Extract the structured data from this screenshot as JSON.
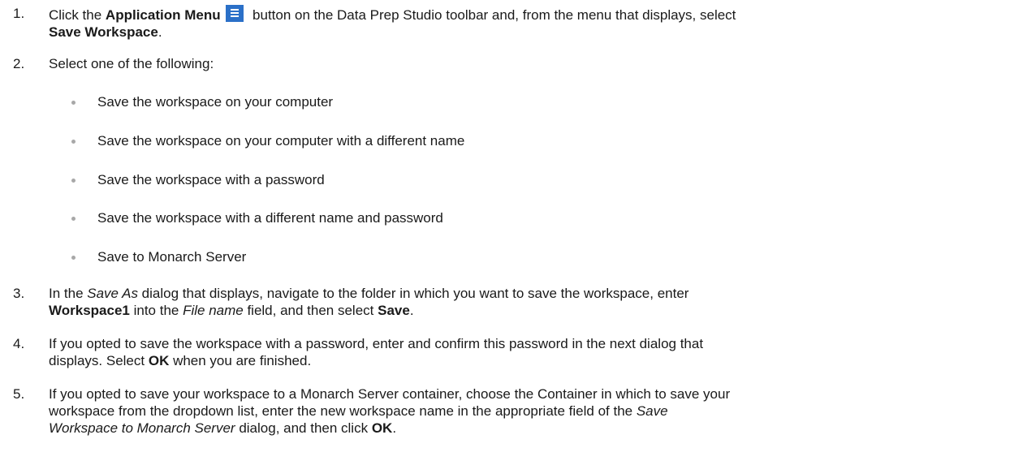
{
  "steps": [
    {
      "num": "1.",
      "t1": "Click the ",
      "b1": "Application Menu",
      "icon": "hamburger-menu-icon",
      "t2": " button on the Data Prep Studio toolbar and, from the menu that displays, select",
      "b2": "Save Workspace",
      "t3": "."
    },
    {
      "num": "2.",
      "t1": "Select one of the following:"
    },
    {
      "num": "3.",
      "t1": "In the ",
      "i1": "Save As",
      "t2": " dialog that displays, navigate to the folder in which you want to save the workspace, enter",
      "b1": "Workspace1",
      "t3": " into the ",
      "i2": "File name",
      "t4": " field, and then select ",
      "b2": "Save",
      "t5": "."
    },
    {
      "num": "4.",
      "t1": "If you opted to save the workspace with a password, enter and confirm this password in the next dialog that",
      "t2": "displays. Select ",
      "b1": "OK",
      "t3": " when you are finished."
    },
    {
      "num": "5.",
      "t1": "If you opted to save your workspace to a Monarch Server container, choose the Container in which to save your",
      "t2": "workspace from the dropdown list, enter the new workspace name in the appropriate field of the ",
      "i1": "Save",
      "i2": "Workspace to Monarch Server",
      "t3": " dialog, and then click ",
      "b1": "OK",
      "t4": "."
    }
  ],
  "options": [
    "Save the workspace on your computer",
    "Save the workspace on your computer with a different name",
    "Save the workspace with a password",
    "Save the workspace with a different name and password",
    "Save to Monarch Server"
  ]
}
